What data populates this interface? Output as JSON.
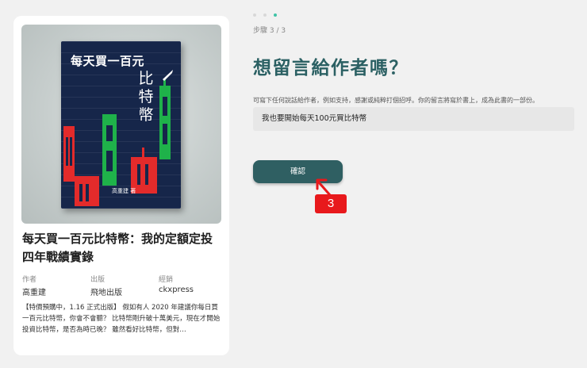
{
  "book": {
    "cover_title": "每天買一百元",
    "cover_subtitle": "比特幣",
    "cover_author": "高重建 著",
    "title": "每天買一百元比特幣：我的定額定投四年戰績實錄",
    "author_label": "作者",
    "author": "高重建",
    "publisher_label": "出版",
    "publisher": "飛地出版",
    "editor_label": "經銷",
    "editor": "ckxpress",
    "blurb": "【特價預購中，1.16 正式出版】 假如有人 2020 年建議你每日買一百元比特幣，你會不會聽？ 比特幣剛升破十萬美元，現在才開始投資比特幣，是否為時已晚？ 雖然看好比特幣，但對…"
  },
  "progress": {
    "total_steps": 3,
    "current_step": 3,
    "label": "步驟 3 / 3"
  },
  "form": {
    "heading": "想留言給作者嗎？",
    "hint": "可寫下任何說話給作者，例如支持，感謝或純粹打個招呼。你的留言將寫於書上，成為此書的一部份。",
    "message_value": "我也要開始每天100元買比特幣",
    "confirm_label": "確認"
  },
  "annotation": {
    "label": "3"
  },
  "colors": {
    "accent": "#2f5f62",
    "heading": "#2b6063",
    "dot_active": "#3fc3a6",
    "badge": "#e8191c",
    "candle_green": "#1fb24a",
    "candle_red": "#e32b2b"
  }
}
